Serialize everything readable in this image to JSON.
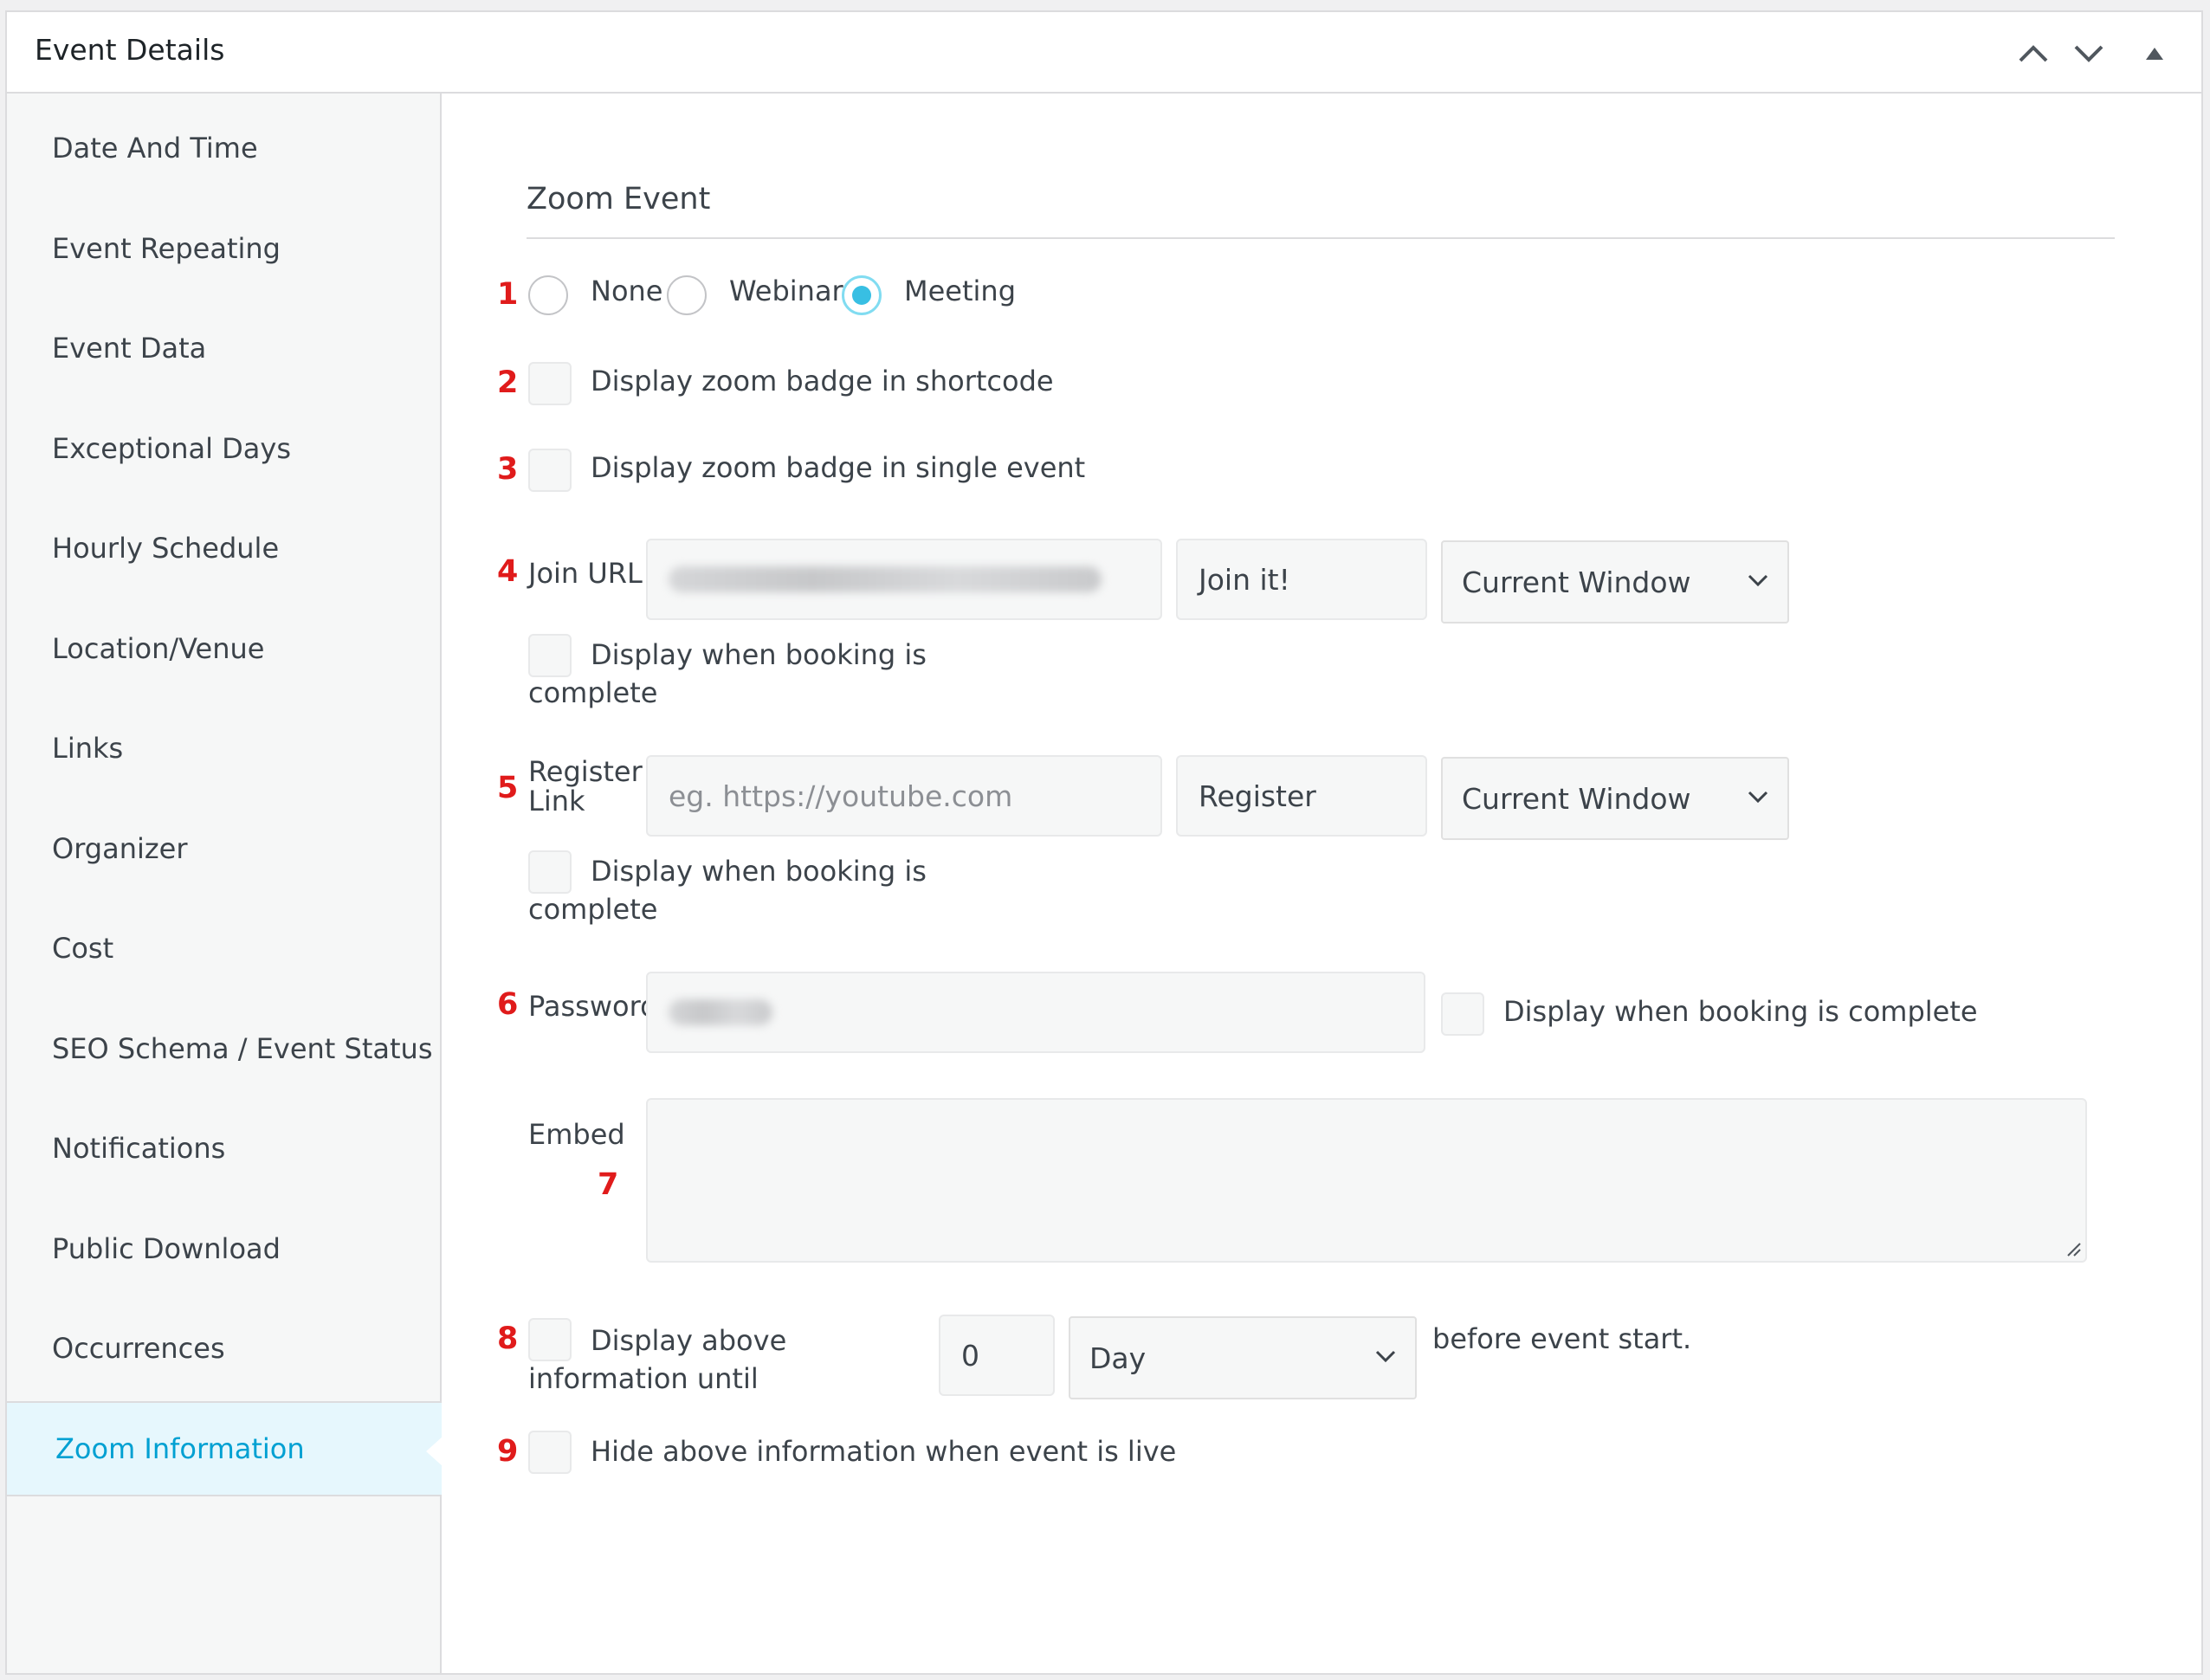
{
  "panel": {
    "title": "Event Details",
    "controls": {
      "move_up": "chevron-up-icon",
      "move_down": "chevron-down-icon",
      "toggle": "triangle-up-icon"
    }
  },
  "sidebar": {
    "items": [
      {
        "label": "Date And Time"
      },
      {
        "label": "Event Repeating"
      },
      {
        "label": "Event Data"
      },
      {
        "label": "Exceptional Days"
      },
      {
        "label": "Hourly Schedule"
      },
      {
        "label": "Location/Venue"
      },
      {
        "label": "Links"
      },
      {
        "label": "Organizer"
      },
      {
        "label": "Cost"
      },
      {
        "label": "SEO Schema / Event Status"
      },
      {
        "label": "Notifications"
      },
      {
        "label": "Public Download"
      },
      {
        "label": "Occurrences"
      },
      {
        "label": "Zoom Information",
        "active": true
      }
    ]
  },
  "zoom": {
    "section_title": "Zoom Event",
    "markers": [
      "1",
      "2",
      "3",
      "4",
      "5",
      "6",
      "7",
      "8",
      "9"
    ],
    "type_options": [
      {
        "label": "None",
        "checked": false
      },
      {
        "label": "Webinar",
        "checked": false
      },
      {
        "label": "Meeting",
        "checked": true
      }
    ],
    "badge_shortcode_label": "Display zoom badge in shortcode",
    "badge_single_label": "Display zoom badge in single event",
    "join": {
      "label": "Join URL",
      "text_value": "Join it!",
      "target": "Current Window",
      "display_line1": "Display when booking is",
      "display_line2": "complete"
    },
    "register": {
      "label_line1": "Register",
      "label_line2": "Link",
      "url_placeholder": "eg. https://youtube.com",
      "text_value": "Register",
      "target": "Current Window",
      "display_line1": "Display when booking is",
      "display_line2": "complete"
    },
    "password": {
      "label": "Password",
      "display_label": "Display when booking is complete"
    },
    "embed": {
      "label": "Embed"
    },
    "display_until": {
      "label_line1": "Display above",
      "label_line2": "information until",
      "value": "0",
      "unit": "Day",
      "suffix": "before event start."
    },
    "hide_live_label": "Hide above information when event is live"
  },
  "colors": {
    "accent": "#00a0d2",
    "radio_fill": "#38bfe3",
    "marker": "#e01b1b"
  }
}
